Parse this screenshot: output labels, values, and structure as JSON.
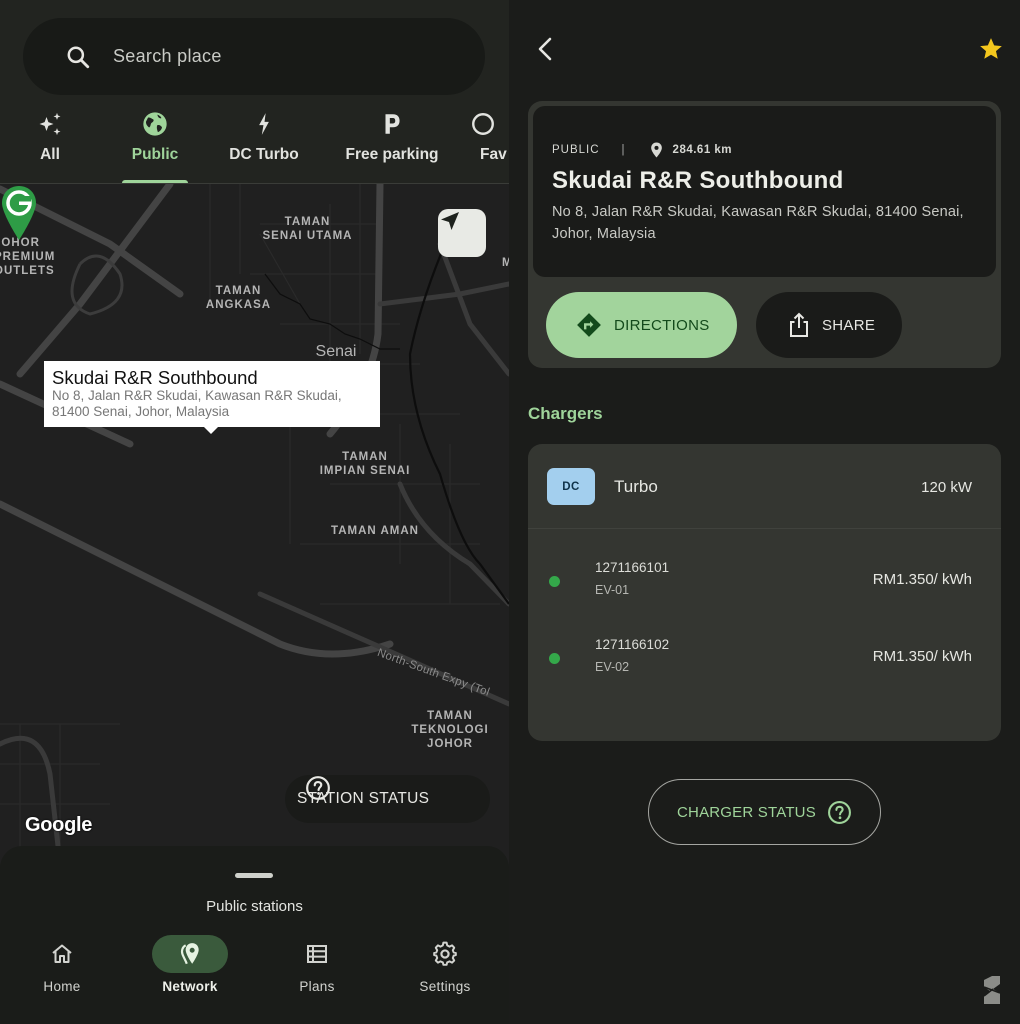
{
  "left": {
    "search": {
      "placeholder": "Search place",
      "icon": "search-icon"
    },
    "filters": [
      {
        "label": "All",
        "icon": "sparkles-icon",
        "active": false
      },
      {
        "label": "Public",
        "icon": "globe-icon",
        "active": true
      },
      {
        "label": "DC Turbo",
        "icon": "bolt-icon",
        "active": false
      },
      {
        "label": "Free parking",
        "icon": "parking-icon",
        "active": false
      },
      {
        "label": "Fav",
        "icon": "favorite-icon",
        "active": false
      }
    ],
    "map": {
      "labels": {
        "johor_premium": "JOHOR\nPREMIUM\nOUTLETS",
        "senai_utama": "TAMAN\nSENAI UTAMA",
        "angkasa": "TAMAN\nANGKASA",
        "senai": "Senai",
        "impian_senai": "TAMAN\nIMPIAN SENAI",
        "aman": "TAMAN AMAN",
        "expressway": "North-South Expy (Tol",
        "teknologi": "TAMAN\nTEKNOLOGI\nJOHOR",
        "edge_m": "M"
      },
      "callout": {
        "title": "Skudai R&R Southbound",
        "address": "No 8, Jalan R&R Skudai, Kawasan R&R Skudai, 81400 Senai, Johor, Malaysia"
      },
      "attribution": "Google",
      "station_status_label": "STATION STATUS",
      "marker_color": "#2e9c46"
    },
    "sheet": {
      "title": "Public stations"
    },
    "nav": [
      {
        "label": "Home",
        "icon": "home-icon",
        "active": false
      },
      {
        "label": "Network",
        "icon": "location-pin-icon",
        "active": true
      },
      {
        "label": "Plans",
        "icon": "list-icon",
        "active": false
      },
      {
        "label": "Settings",
        "icon": "gear-icon",
        "active": false
      }
    ]
  },
  "right": {
    "favorite_color": "#f4c71d",
    "station": {
      "access": "PUBLIC",
      "separator": "|",
      "distance": "284.61 km",
      "name": "Skudai R&R Southbound",
      "address": "No 8, Jalan R&R Skudai, Kawasan R&R Skudai, 81400 Senai, Johor, Malaysia"
    },
    "actions": {
      "directions": "DIRECTIONS",
      "share": "SHARE"
    },
    "chargers_heading": "Chargers",
    "charger_group": {
      "badge": "DC",
      "type": "Turbo",
      "power": "120 kW",
      "connectors": [
        {
          "id": "1271166101",
          "name": "EV-01",
          "price": "RM1.350/ kWh",
          "status": "available"
        },
        {
          "id": "1271166102",
          "name": "EV-02",
          "price": "RM1.350/ kWh",
          "status": "available"
        }
      ]
    },
    "charger_status_label": "CHARGER STATUS",
    "accent_color": "#9fd49a"
  }
}
